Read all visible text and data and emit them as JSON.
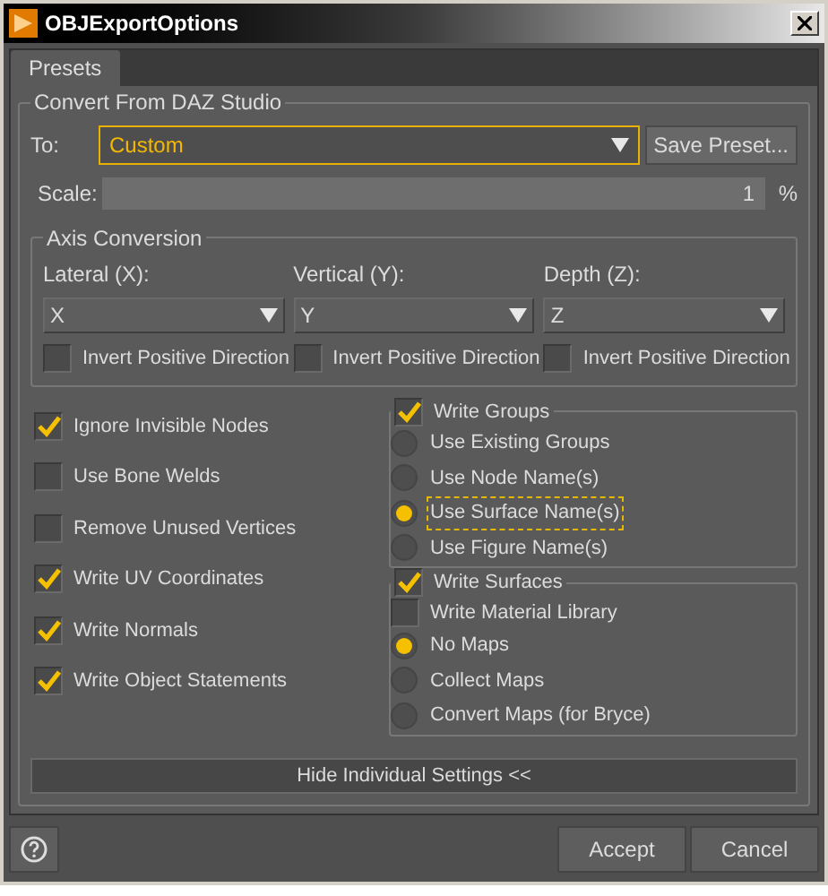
{
  "window": {
    "title": "OBJExportOptions"
  },
  "tabs": [
    {
      "label": "Presets",
      "selected": true
    }
  ],
  "convert": {
    "title": "Convert From DAZ Studio",
    "to_label": "To:",
    "preset": "Custom",
    "save_button": "Save Preset...",
    "scale_label": "Scale:",
    "scale_value": "1",
    "scale_unit": "%"
  },
  "axis": {
    "title": "Axis Conversion",
    "axes": [
      {
        "label": "Lateral (X):",
        "value": "X",
        "invert_label": "Invert Positive Direction",
        "invert_checked": false
      },
      {
        "label": "Vertical (Y):",
        "value": "Y",
        "invert_label": "Invert Positive Direction",
        "invert_checked": false
      },
      {
        "label": "Depth (Z):",
        "value": "Z",
        "invert_label": "Invert Positive Direction",
        "invert_checked": false
      }
    ]
  },
  "options": [
    {
      "label": "Ignore Invisible Nodes",
      "checked": true
    },
    {
      "label": "Use Bone Welds",
      "checked": false
    },
    {
      "label": "Remove Unused Vertices",
      "checked": false
    },
    {
      "label": "Write UV Coordinates",
      "checked": true
    },
    {
      "label": "Write Normals",
      "checked": true
    },
    {
      "label": "Write Object Statements",
      "checked": true
    }
  ],
  "write_groups": {
    "label": "Write Groups",
    "checked": true,
    "items": [
      {
        "kind": "radio",
        "label": "Use Existing Groups",
        "selected": false,
        "focused": false
      },
      {
        "kind": "radio",
        "label": "Use Node Name(s)",
        "selected": false,
        "focused": false
      },
      {
        "kind": "radio",
        "label": "Use Surface Name(s)",
        "selected": true,
        "focused": true
      },
      {
        "kind": "radio",
        "label": "Use Figure Name(s)",
        "selected": false,
        "focused": false
      }
    ]
  },
  "write_surfaces": {
    "label": "Write Surfaces",
    "checked": true,
    "items": [
      {
        "kind": "checkbox",
        "label": "Write Material Library",
        "checked": false
      },
      {
        "kind": "radio",
        "label": "No Maps",
        "selected": true,
        "focused": false
      },
      {
        "kind": "radio",
        "label": "Collect Maps",
        "selected": false,
        "focused": false
      },
      {
        "kind": "radio",
        "label": "Convert Maps (for Bryce)",
        "selected": false,
        "focused": false
      }
    ]
  },
  "hide_button": "Hide Individual Settings <<",
  "footer": {
    "accept": "Accept",
    "cancel": "Cancel"
  }
}
